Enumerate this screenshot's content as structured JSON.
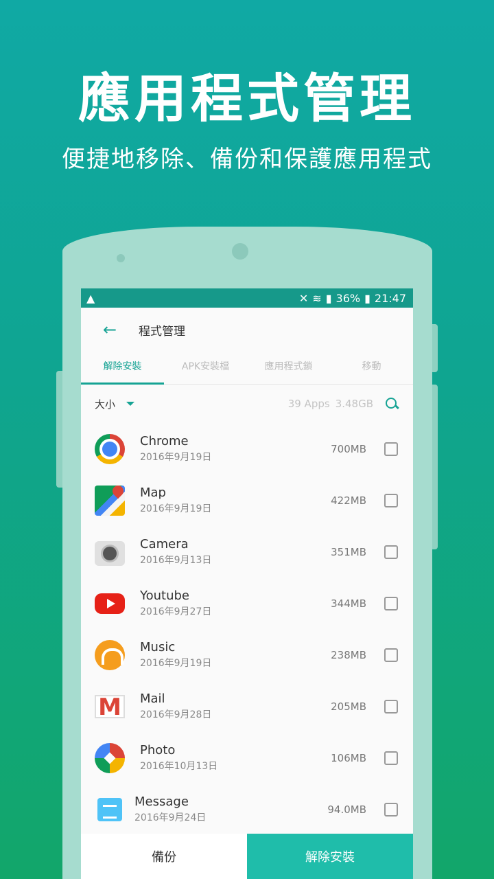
{
  "promo": {
    "title": "應用程式管理",
    "subtitle": "便捷地移除、備份和保護應用程式"
  },
  "statusbar": {
    "battery": "36%",
    "time": "21:47"
  },
  "appbar": {
    "title": "程式管理"
  },
  "tabs": [
    {
      "label": "解除安裝"
    },
    {
      "label": "APK安裝檔"
    },
    {
      "label": "應用程式鎖"
    },
    {
      "label": "移動"
    }
  ],
  "filter": {
    "sort_label": "大小",
    "app_count": "39 Apps",
    "total_size": "3.48GB"
  },
  "apps": [
    {
      "name": "Chrome",
      "date": "2016年9月19日",
      "size": "700MB"
    },
    {
      "name": "Map",
      "date": "2016年9月19日",
      "size": "422MB"
    },
    {
      "name": "Camera",
      "date": "2016年9月13日",
      "size": "351MB"
    },
    {
      "name": "Youtube",
      "date": "2016年9月27日",
      "size": "344MB"
    },
    {
      "name": "Music",
      "date": "2016年9月19日",
      "size": "238MB"
    },
    {
      "name": "Mail",
      "date": "2016年9月28日",
      "size": "205MB"
    },
    {
      "name": "Photo",
      "date": "2016年10月13日",
      "size": "106MB"
    },
    {
      "name": "Message",
      "date": "2016年9月24日",
      "size": "94.0MB"
    }
  ],
  "actions": {
    "backup_label": "備份",
    "uninstall_label": "解除安裝"
  },
  "colors": {
    "accent": "#16a394",
    "statusbar": "#16998a",
    "primary_button": "#1fbdaa"
  }
}
